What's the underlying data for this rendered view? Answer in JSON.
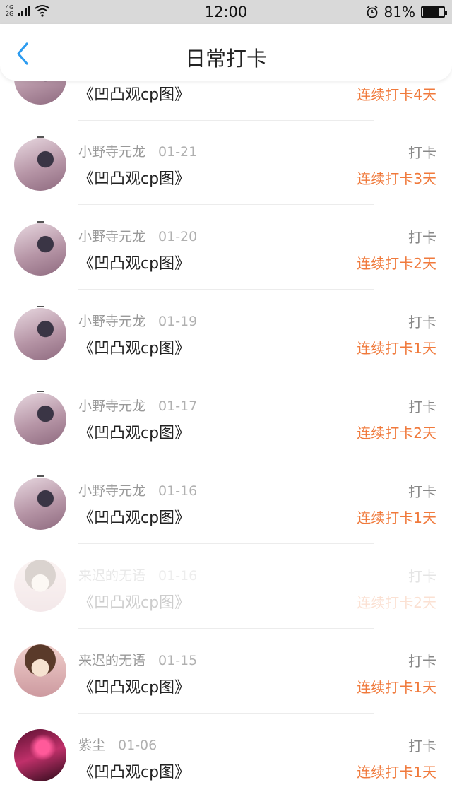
{
  "status": {
    "network_top": "4G",
    "network_bottom": "2G",
    "time": "12:00",
    "battery": "81%",
    "battery_level": 0.81
  },
  "nav": {
    "title": "日常打卡",
    "back_icon": "chevron-left-icon",
    "accent": "#2d9cf0"
  },
  "items": [
    {
      "name": "",
      "date": "",
      "title": "《凹凸观cp图》",
      "label": "",
      "streak": "连续打卡4天",
      "avatar": "girl"
    },
    {
      "name": "小野寺元龙",
      "date": "01-21",
      "title": "《凹凸观cp图》",
      "label": "打卡",
      "streak": "连续打卡3天",
      "avatar": "girl"
    },
    {
      "name": "小野寺元龙",
      "date": "01-20",
      "title": "《凹凸观cp图》",
      "label": "打卡",
      "streak": "连续打卡2天",
      "avatar": "girl"
    },
    {
      "name": "小野寺元龙",
      "date": "01-19",
      "title": "《凹凸观cp图》",
      "label": "打卡",
      "streak": "连续打卡1天",
      "avatar": "girl"
    },
    {
      "name": "小野寺元龙",
      "date": "01-17",
      "title": "《凹凸观cp图》",
      "label": "打卡",
      "streak": "连续打卡2天",
      "avatar": "girl"
    },
    {
      "name": "小野寺元龙",
      "date": "01-16",
      "title": "《凹凸观cp图》",
      "label": "打卡",
      "streak": "连续打卡1天",
      "avatar": "girl"
    },
    {
      "name": "来迟的无语",
      "date": "01-16",
      "title": "《凹凸观cp图》",
      "label": "打卡",
      "streak": "连续打卡2天",
      "avatar": "chibi"
    },
    {
      "name": "来迟的无语",
      "date": "01-15",
      "title": "《凹凸观cp图》",
      "label": "打卡",
      "streak": "连续打卡1天",
      "avatar": "chibi"
    },
    {
      "name": "紫尘",
      "date": "01-06",
      "title": "《凹凸观cp图》",
      "label": "打卡",
      "streak": "连续打卡1天",
      "avatar": "neon"
    }
  ],
  "colors": {
    "streak": "#f07a3c",
    "name": "#999999"
  }
}
